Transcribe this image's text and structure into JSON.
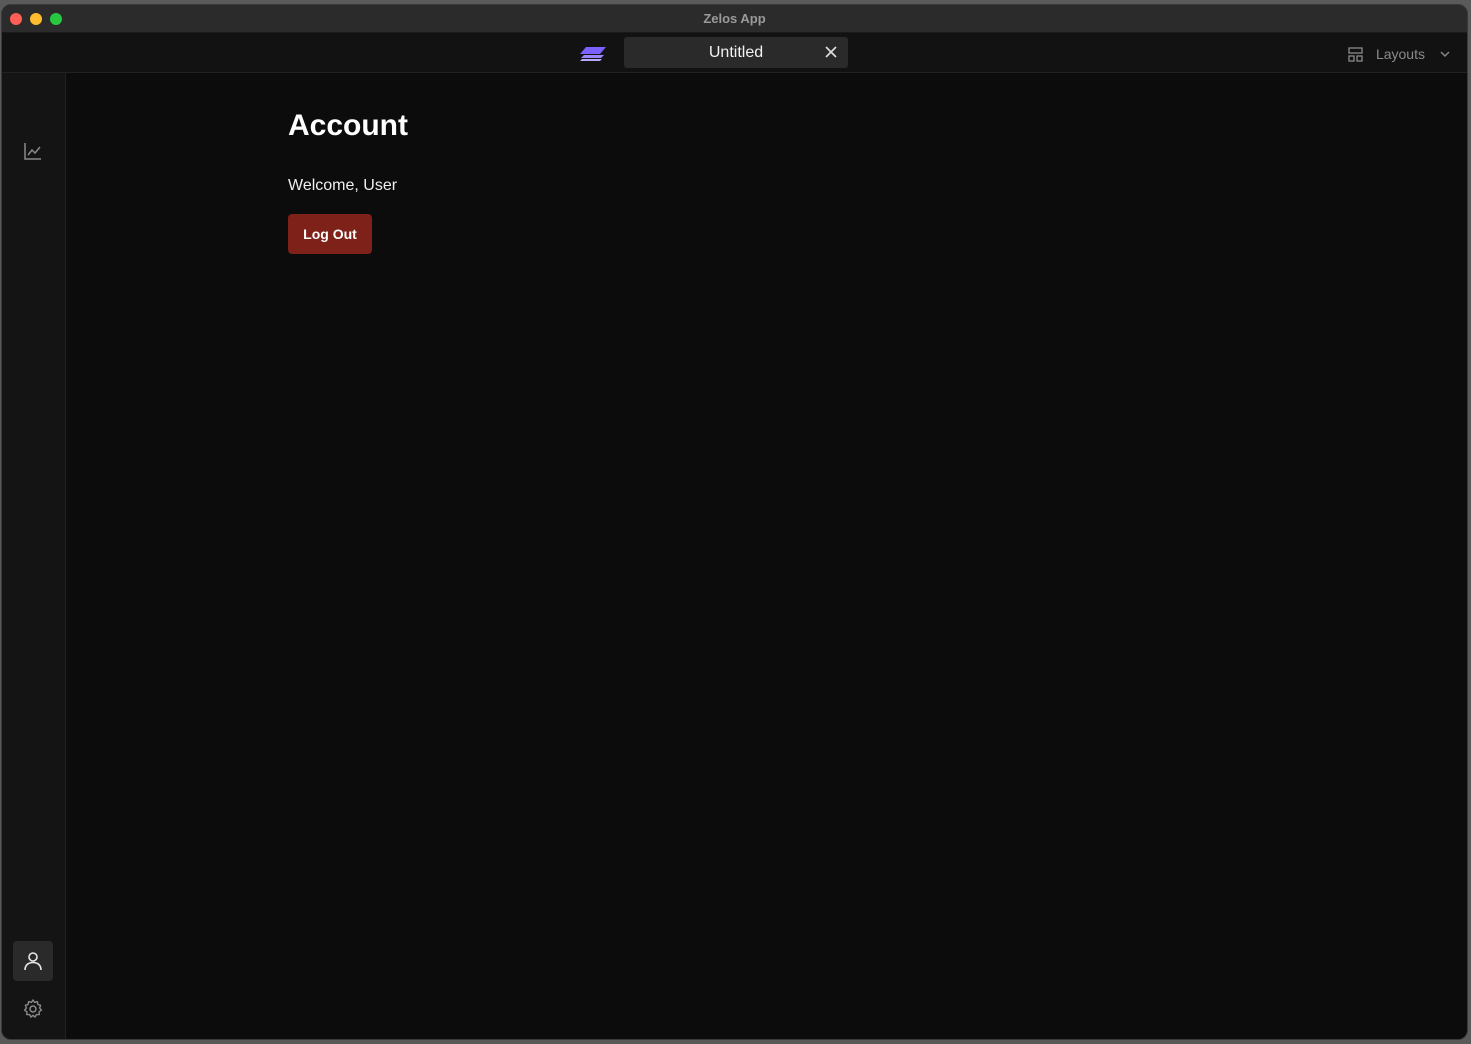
{
  "window": {
    "title": "Zelos App"
  },
  "tabbar": {
    "tab_label": "Untitled",
    "layouts_label": "Layouts"
  },
  "sidebar": {
    "items": [
      {
        "name": "charts",
        "icon": "line-chart-icon",
        "active": false
      },
      {
        "name": "account",
        "icon": "user-icon",
        "active": true
      },
      {
        "name": "settings",
        "icon": "gear-icon",
        "active": false
      }
    ]
  },
  "account": {
    "title": "Account",
    "welcome": "Welcome, User",
    "logout_label": "Log Out"
  },
  "colors": {
    "logout_button": "#7d2119",
    "logo_accent": "#7b61ff",
    "background": "#0c0c0c"
  }
}
